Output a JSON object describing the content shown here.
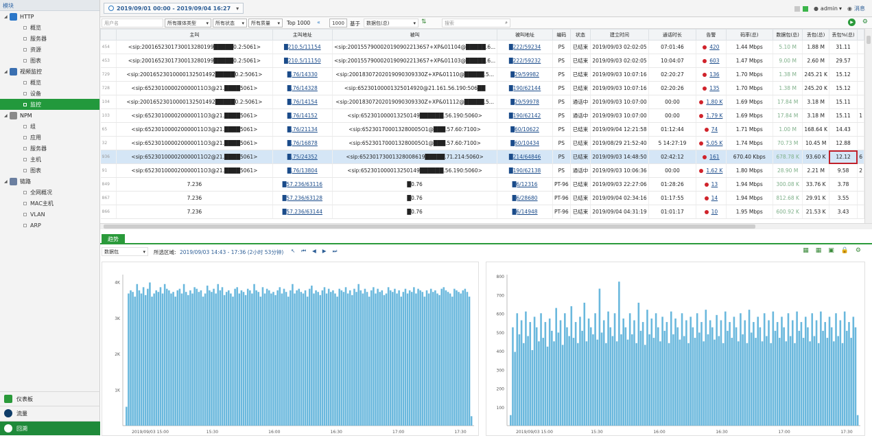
{
  "sidebar": {
    "title": "模块",
    "groups": [
      {
        "label": "HTTP",
        "color": "#2c77c8",
        "items": [
          "概览",
          "服务器",
          "资源",
          "图表"
        ]
      },
      {
        "label": "视频监控",
        "color": "#3a6fb0",
        "items": [
          "概览",
          "设备",
          "监控"
        ],
        "active": 2
      },
      {
        "label": "NPM",
        "color": "#8a8a8a",
        "items": [
          "组",
          "应用",
          "服务器",
          "主机",
          "图表"
        ]
      },
      {
        "label": "链路",
        "color": "#6b7fa0",
        "items": [
          "全网概况",
          "MAC主机",
          "VLAN",
          "ARP"
        ]
      }
    ],
    "bottom": [
      {
        "label": "仪表板",
        "color": "#2a9a3a"
      },
      {
        "label": "流量",
        "color": "#0e3c68"
      },
      {
        "label": "回溯",
        "color": "#1f8a3a"
      }
    ]
  },
  "topbar": {
    "date_range": "2019/09/01 00:00 - 2019/09/04 16:27",
    "user": "admin",
    "message": "消息"
  },
  "filters": {
    "search_left_placeholder": "用户名",
    "media_type": "所有媒体类型",
    "status": "所有状态",
    "quality": "所有质量",
    "top_label": "Top 1000",
    "top_value": "1000",
    "basis_label": "基于",
    "basis": "数据包(总)",
    "search_placeholder": "搜索"
  },
  "table": {
    "columns": [
      "",
      "主叫",
      "主叫地址",
      "被叫",
      "被叫地址",
      "编码",
      "状态",
      "建立时间",
      "通话时长",
      "告警",
      "码率(总)",
      "数据包(总)",
      "丢包(总)",
      "丢包%(总)",
      ""
    ],
    "rows": [
      [
        "454",
        "<sip:2001652301730013280199█████0.2:5061>",
        "█210.5/11154",
        "<sip:20015579000201909022136S7+XP&01104@█████.6...",
        "█222/59234",
        "PS",
        "已结束",
        "2019/09/03 02:02:05",
        "07:01:46",
        "420",
        "1.44 Mbps",
        "5.10 M",
        "1.88 M",
        "31.11",
        ""
      ],
      [
        "453",
        "<sip:2001652301730013280199█████0.2:5061>",
        "█210.5/11150",
        "<sip:20015579000201909022136S7+XP&01103@█████.6...",
        "█222/59232",
        "PS",
        "已结束",
        "2019/09/03 02:02:05",
        "10:04:07",
        "603",
        "1.47 Mbps",
        "9.00 M",
        "2.60 M",
        "29.57",
        ""
      ],
      [
        "729",
        "<sip:20016523010000132501492█████0.2:5061>",
        "█.76/14330",
        "<sip:20018307202019090309330Z+XP&01110@█████.5...",
        "█29/59982",
        "PS",
        "已结束",
        "2019/09/03 10:07:16",
        "02:20:27",
        "136",
        "1.70 Mbps",
        "1.38 M",
        "245.21 K",
        "15.12",
        ""
      ],
      [
        "728",
        "<sip:652301000020000011O3@21.████5061>",
        "█.76/14328",
        "<sip:65230100001325014920@21.161.56.190:506██",
        "█190/62144",
        "PS",
        "已结束",
        "2019/09/03 10:07:16",
        "02:20:26",
        "135",
        "1.70 Mbps",
        "1.38 M",
        "245.20 K",
        "15.12",
        ""
      ],
      [
        "104",
        "<sip:20016523010000132501492█████0.2:5061>",
        "█.76/14154",
        "<sip:20018307202019090309330Z+XP&01112@█████.5...",
        "█29/59978",
        "PS",
        "通话中",
        "2019/09/03 10:07:00",
        "00:00",
        "1.80 K",
        "1.69 Mbps",
        "17.84 M",
        "3.18 M",
        "15.11",
        ""
      ],
      [
        "103",
        "<sip:652301000020000011O3@21.████5061>",
        "█.76/14152",
        "<sip:652301000013250149██████.56.190:5060>",
        "█190/62142",
        "PS",
        "通话中",
        "2019/09/03 10:07:00",
        "00:00",
        "1.79 K",
        "1.69 Mbps",
        "17.84 M",
        "3.18 M",
        "15.11",
        "1"
      ],
      [
        "65",
        "<sip:652301000020000011O3@21.████5061>",
        "█.76/21134",
        "<sip:652301700013280005O1@███.57.60:7100>",
        "█60/10622",
        "PS",
        "已结束",
        "2019/09/04 12:21:58",
        "01:12:44",
        "74",
        "1.71 Mbps",
        "1.00 M",
        "168.64 K",
        "14.43",
        ""
      ],
      [
        "32",
        "<sip:652301000020000011O3@21.████5061>",
        "█.76/16878",
        "<sip:652301700013280005O1@███.57.60:7100>",
        "█60/10434",
        "PS",
        "已结束",
        "2019/08/29 21:52:40",
        "5 14:27:19",
        "5.05 K",
        "1.74 Mbps",
        "70.73 M",
        "10.45 M",
        "12.88",
        ""
      ],
      [
        "936",
        "<sip:652301000020000011O2@21.████5061>",
        "█.75/24352",
        "<sip:65230173001328008619█████.71.214:5060>",
        "█214/64846",
        "PS",
        "已结束",
        "2019/09/03 14:48:50",
        "02:42:12",
        "161",
        "670.40 Kbps",
        "678.78 K",
        "93.60 K",
        "12.12",
        "6"
      ],
      [
        "91",
        "<sip:652301000020000011O3@21.████5061>",
        "█.76/13804",
        "<sip:652301000013250149██████.56.190:5060>",
        "█190/62138",
        "PS",
        "通话中",
        "2019/09/03 10:06:36",
        "00:00",
        "1.62 K",
        "1.80 Mbps",
        "28.90 M",
        "2.21 M",
        "9.58",
        "2"
      ],
      [
        "849",
        "7.236",
        "█57.236/63116",
        "█0.76",
        "█6/12316",
        "PT-96",
        "已结束",
        "2019/09/03 22:27:06",
        "01:28:26",
        "13",
        "1.94 Mbps",
        "300.08 K",
        "33.76 K",
        "3.78",
        ""
      ],
      [
        "867",
        "7.236",
        "█57.236/63128",
        "█0.76",
        "█6/28680",
        "PT-96",
        "已结束",
        "2019/09/04 02:34:16",
        "01:17:55",
        "14",
        "1.94 Mbps",
        "812.68 K",
        "29.91 K",
        "3.55",
        ""
      ],
      [
        "866",
        "7.236",
        "█57.236/63144",
        "█0.76",
        "█6/14948",
        "PT-96",
        "已结束",
        "2019/09/04 04:31:19",
        "01:01:17",
        "10",
        "1.95 Mbps",
        "600.92 K",
        "21.53 K",
        "3.43",
        ""
      ]
    ],
    "selected_row": 8
  },
  "trend": {
    "tab": "趋势",
    "metric": "数据包",
    "range_label": "所选区域:",
    "range_value": "2019/09/03 14:43 - 17:36 (2小时 53分钟)"
  },
  "chart_data": [
    {
      "type": "bar",
      "title": "",
      "xlabel": "",
      "ylabel": "",
      "ylim": [
        0,
        4800
      ],
      "yticks": [
        "1K",
        "2K",
        "3K",
        "4K"
      ],
      "xticks": [
        "2019/09/03 15:00",
        "15:30",
        "16:00",
        "16:30",
        "17:00",
        "17:30"
      ],
      "color": "#6ab8dd",
      "values": [
        600,
        4200,
        4300,
        4250,
        4100,
        4500,
        4300,
        4200,
        4400,
        4150,
        4350,
        4550,
        4100,
        4200,
        4300,
        4250,
        4400,
        4200,
        4500,
        4350,
        4300,
        4200,
        4250,
        4100,
        4300,
        4350,
        4200,
        4500,
        4250,
        4150,
        4300,
        4200,
        4400,
        4350,
        4250,
        4300,
        4100,
        4200,
        4450,
        4300,
        4250,
        4350,
        4200,
        4500,
        4300,
        4400,
        4150,
        4250,
        4300,
        4200,
        4100,
        4350,
        4400,
        4200,
        4300,
        4250,
        4150,
        4350,
        4300,
        4200,
        4500,
        4300,
        4250,
        4100,
        4400,
        4200,
        4350,
        4300,
        4200,
        4250,
        4150,
        4300,
        4400,
        4200,
        4350,
        4250,
        4100,
        4300,
        4500,
        4200,
        4300,
        4350,
        4250,
        4200,
        4300,
        4100,
        4350,
        4450,
        4200,
        4300,
        4250,
        4150,
        4300,
        4400,
        4200,
        4350,
        4250,
        4300,
        4200,
        4100,
        4350,
        4300,
        4250,
        4400,
        4200,
        4300,
        4150,
        4350,
        4250,
        4500,
        4300,
        4200,
        4350,
        4250,
        4100,
        4300,
        4400,
        4200,
        4350,
        4250,
        4300,
        4150,
        4200,
        4400,
        4300,
        4250,
        4350,
        4200,
        4300,
        4100,
        4250,
        4350,
        4200,
        4300,
        4250,
        4400,
        4200,
        4350,
        4300,
        4250,
        4100,
        4300,
        4200,
        4350,
        4250,
        4300,
        4200,
        4150,
        4350,
        4400,
        4300,
        4250,
        4200,
        4100,
        4350,
        4300,
        4250,
        4200,
        4300,
        4350,
        4250,
        4100,
        300
      ]
    },
    {
      "type": "bar",
      "title": "",
      "xlabel": "",
      "ylabel": "",
      "ylim": [
        0,
        860
      ],
      "yticks": [
        "100",
        "200",
        "300",
        "400",
        "500",
        "600",
        "700",
        "800"
      ],
      "xticks": [
        "2019/09/03 15:00",
        "15:30",
        "16:00",
        "16:30",
        "17:00",
        "17:30"
      ],
      "color": "#6ab8dd",
      "values": [
        60,
        560,
        420,
        640,
        520,
        600,
        470,
        650,
        510,
        590,
        430,
        620,
        560,
        480,
        640,
        500,
        590,
        450,
        610,
        540,
        480,
        670,
        530,
        600,
        460,
        640,
        560,
        510,
        680,
        500,
        590,
        470,
        620,
        540,
        700,
        480,
        610,
        560,
        520,
        640,
        490,
        780,
        530,
        600,
        470,
        650,
        560,
        510,
        640,
        480,
        820,
        520,
        610,
        560,
        490,
        640,
        520,
        600,
        470,
        700,
        540,
        590,
        460,
        660,
        520,
        610,
        500,
        640,
        560,
        480,
        620,
        540,
        590,
        470,
        650,
        520,
        610,
        560,
        490,
        640,
        510,
        600,
        470,
        620,
        560,
        500,
        640,
        530,
        590,
        480,
        660,
        520,
        600,
        560,
        490,
        630,
        510,
        600,
        470,
        650,
        540,
        590,
        500,
        620,
        560,
        480,
        640,
        520,
        600,
        470,
        660,
        530,
        590,
        500,
        620,
        560,
        480,
        640,
        510,
        600,
        470,
        650,
        540,
        590,
        500,
        620,
        560,
        480,
        640,
        510,
        600,
        470,
        650,
        540,
        590,
        500,
        620,
        560,
        480,
        640,
        510,
        600,
        470,
        650,
        540,
        590,
        500,
        620,
        560,
        480,
        640,
        510,
        600,
        470,
        650,
        540,
        590,
        500,
        620,
        560,
        60
      ]
    }
  ]
}
